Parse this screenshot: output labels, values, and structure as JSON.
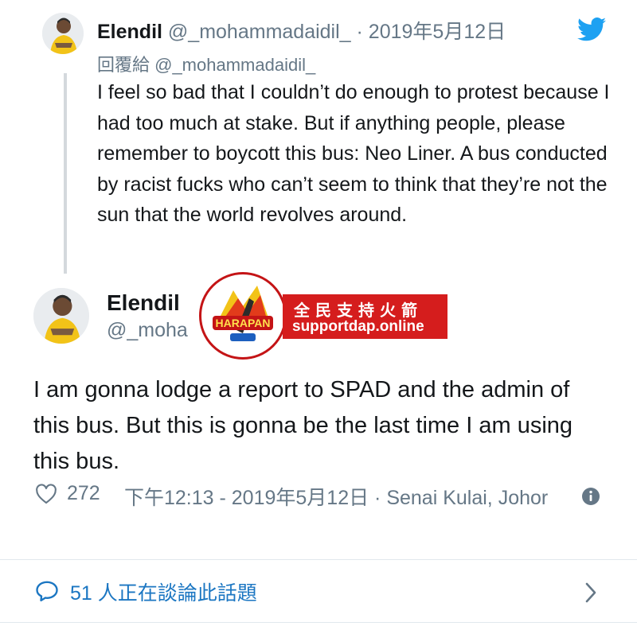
{
  "reply_tweet": {
    "name": "Elendil",
    "handle": "@_mohammadaidil_",
    "separator": " · ",
    "date": "2019年5月12日",
    "reply_to": "回覆給 @_mohammadaidil_",
    "body": "I feel so bad that I couldn’t do enough to protest because I had too much at stake. But if anything people, please remember to boycott this bus: Neo Liner. A bus conducted by racist fucks who can’t seem to think that they’re not the sun that the world revolves around."
  },
  "main_tweet": {
    "name": "Elendil",
    "handle": "@_moha",
    "body": "I am gonna lodge a report to SPAD and the admin of this bus. But this is gonna be the last time I am using this bus.",
    "likes": "272",
    "time_location": "下午12:13 - 2019年5月12日 · Senai Kulai, Johor"
  },
  "ad_overlay": {
    "badge_text": "HARAPAN",
    "title": "全民支持火箭",
    "url": "supportdap.online"
  },
  "conversation": {
    "label": "51 人正在談論此話題"
  },
  "icons": {
    "logo": "twitter-bird-icon",
    "like": "heart-icon",
    "info": "info-icon",
    "reply": "speech-bubble-icon",
    "more": "chevron-right-icon"
  },
  "colors": {
    "twitter_blue": "#1da1f2",
    "link_blue": "#1b76c2",
    "muted": "#657786",
    "ad_red": "#d51d1d"
  }
}
